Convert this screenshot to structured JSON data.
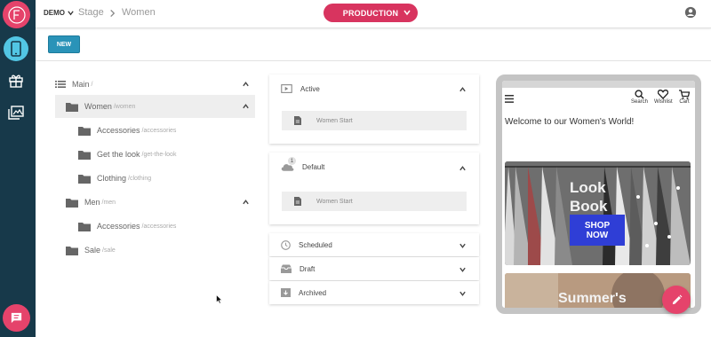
{
  "app": {
    "logo_letter": "F"
  },
  "header": {
    "project": "DEMO",
    "breadcrumb": [
      "Stage",
      "Women"
    ],
    "environment": "PRODUCTION"
  },
  "toolbar": {
    "new_label": "NEW"
  },
  "tree": {
    "nodes": [
      {
        "label": "Main",
        "path": "/"
      },
      {
        "label": "Women",
        "path": "/women"
      },
      {
        "label": "Accessories",
        "path": "/accessories"
      },
      {
        "label": "Get the look",
        "path": "/get-the-look"
      },
      {
        "label": "Clothing",
        "path": "/clothing"
      },
      {
        "label": "Men",
        "path": "/men"
      },
      {
        "label": "Accessories",
        "path": "/accessories"
      },
      {
        "label": "Sale",
        "path": "/sale"
      }
    ]
  },
  "panels": {
    "active": {
      "title": "Active",
      "entry": "Women Start"
    },
    "default": {
      "title": "Default",
      "badge": "1",
      "entry": "Women Start"
    },
    "scheduled": {
      "title": "Scheduled"
    },
    "draft": {
      "title": "Draft"
    },
    "archived": {
      "title": "Archived"
    }
  },
  "preview": {
    "nav": {
      "search": "Search",
      "wishlist": "Wishlist",
      "cart": "Cart"
    },
    "welcome": "Welcome to our Women's World!",
    "hero_title_1": "Look",
    "hero_title_2": "Book",
    "shop_line_1": "SHOP",
    "shop_line_2": "NOW",
    "banner2_text": "Summer's"
  },
  "colors": {
    "rail": "#17394a",
    "accent_pink": "#e5436b",
    "environment_button": "#d8345f",
    "new_button": "#2a93b8",
    "active_rail_item": "#52c6e4",
    "shop_button": "#2f3ed6"
  },
  "icons": [
    "logo-icon",
    "mobile-icon",
    "gift-icon",
    "images-icon",
    "chat-icon",
    "user-account-icon",
    "list-icon",
    "folder-icon",
    "play-icon",
    "cloud-icon",
    "page-icon",
    "clock-icon",
    "inbox-icon",
    "archive-icon",
    "search-icon",
    "wishlist-icon",
    "cart-icon",
    "menu-icon",
    "edit-icon"
  ]
}
